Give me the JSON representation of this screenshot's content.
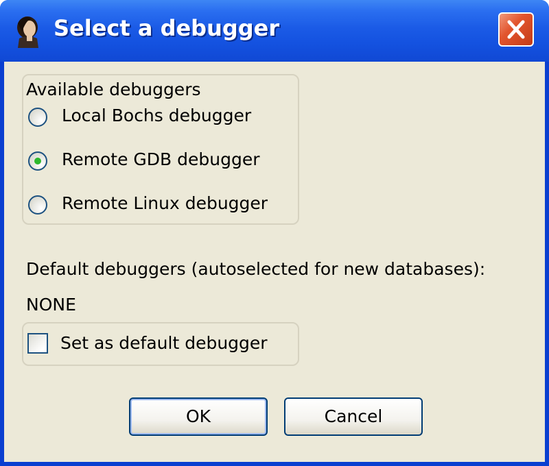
{
  "window": {
    "title": "Select a debugger",
    "close_icon": "close-icon"
  },
  "available": {
    "group_label": "Available debuggers",
    "options": [
      {
        "label": "Local Bochs debugger",
        "selected": false
      },
      {
        "label": "Remote GDB debugger",
        "selected": true
      },
      {
        "label": "Remote Linux debugger",
        "selected": false
      }
    ]
  },
  "defaults": {
    "label": "Default debuggers (autoselected for new databases):",
    "value": "NONE",
    "set_default_label": "Set as default debugger",
    "set_default_checked": false
  },
  "buttons": {
    "ok": "OK",
    "cancel": "Cancel"
  },
  "colors": {
    "titlebar": "#1452e0",
    "client_bg": "#ece9d8",
    "close_red": "#e2552e",
    "radio_selected": "#2db82d"
  }
}
